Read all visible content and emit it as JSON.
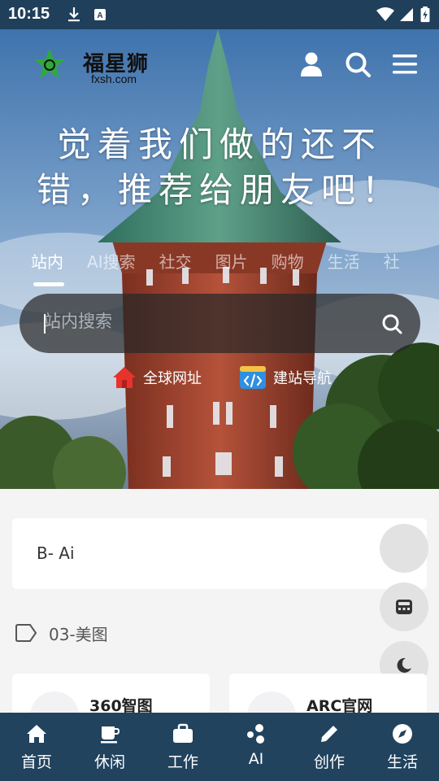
{
  "status_bar": {
    "time": "10:15"
  },
  "header": {
    "logo_cn": "福星狮",
    "logo_en": "fxsh.com"
  },
  "hero": {
    "headline_line1": "觉着我们做的还不",
    "headline_line2": "错，推荐给朋友吧！",
    "tabs": [
      {
        "label": "站内"
      },
      {
        "label": "AI搜索"
      },
      {
        "label": "社交"
      },
      {
        "label": "图片"
      },
      {
        "label": "购物"
      },
      {
        "label": "生活"
      },
      {
        "label": "社"
      }
    ],
    "search": {
      "placeholder": "站内搜索",
      "value": ""
    },
    "quick_links": [
      {
        "label": "全球网址"
      },
      {
        "label": "建站导航"
      }
    ]
  },
  "content": {
    "ai_card_title": "B- Ai",
    "section_title": "03-美图",
    "sites": [
      {
        "name": "360智图"
      },
      {
        "name": "ARC官网"
      }
    ]
  },
  "bottom_nav": {
    "items": [
      {
        "label": "首页",
        "icon": "home-icon"
      },
      {
        "label": "休闲",
        "icon": "coffee-icon"
      },
      {
        "label": "工作",
        "icon": "briefcase-icon"
      },
      {
        "label": "AI",
        "icon": "ai-icon"
      },
      {
        "label": "创作",
        "icon": "pencil-icon"
      },
      {
        "label": "生活",
        "icon": "compass-icon"
      }
    ]
  },
  "colors": {
    "status_bar": "#1f3f5a",
    "bottom_nav": "#21435e",
    "logo_green": "#2eaa3c",
    "quick_link_red": "#e8322c",
    "quick_link_blue": "#2f8fe0"
  }
}
